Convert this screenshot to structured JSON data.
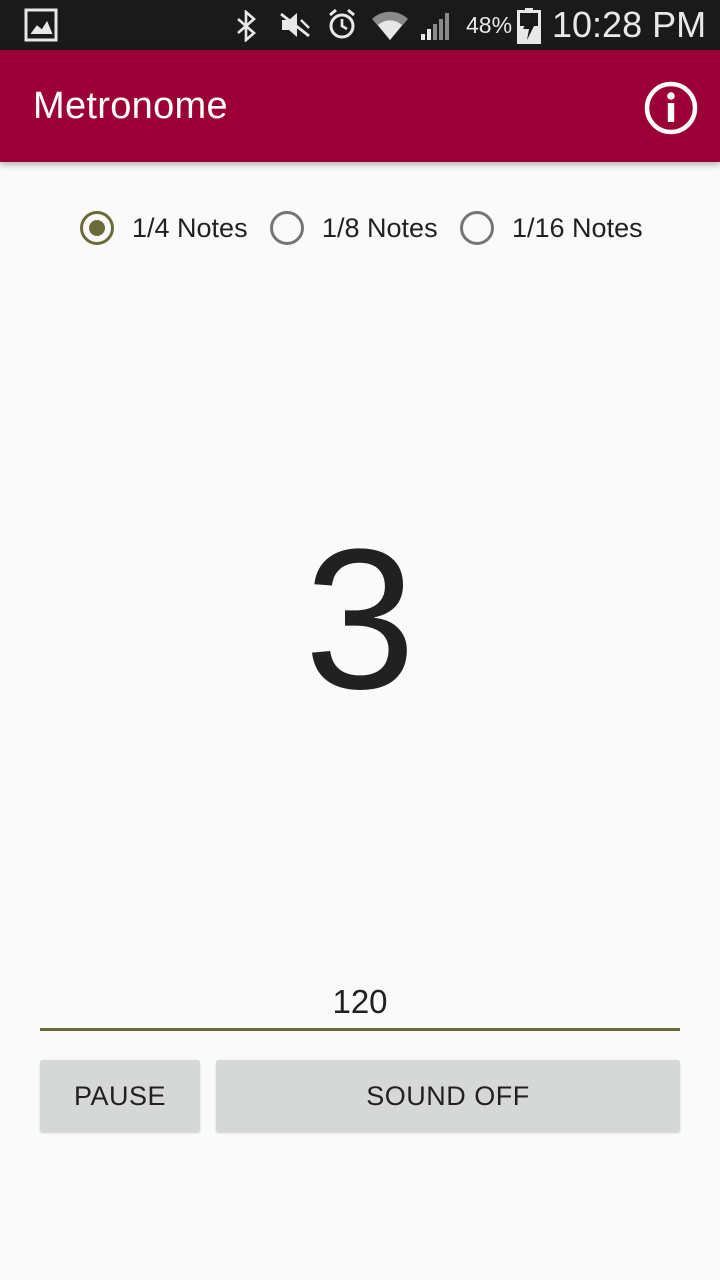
{
  "status_bar": {
    "battery_percent": "48%",
    "time": "10:28 PM",
    "icons": [
      "gallery-icon",
      "bluetooth-icon",
      "mute-icon",
      "alarm-icon",
      "wifi-icon",
      "signal-icon",
      "battery-charging-icon"
    ]
  },
  "app_bar": {
    "title": "Metronome",
    "info_icon": "info-icon",
    "background_color": "#9b0036"
  },
  "note_options": [
    {
      "label": "1/4 Notes",
      "checked": true
    },
    {
      "label": "1/8 Notes",
      "checked": false
    },
    {
      "label": "1/16 Notes",
      "checked": false
    }
  ],
  "beat_count": "3",
  "tempo": {
    "value": "120"
  },
  "buttons": {
    "pause": "PAUSE",
    "sound": "SOUND OFF"
  },
  "colors": {
    "accent": "#6b6b3a",
    "button_bg": "#d6d7d7",
    "page_bg": "#fafafa"
  }
}
